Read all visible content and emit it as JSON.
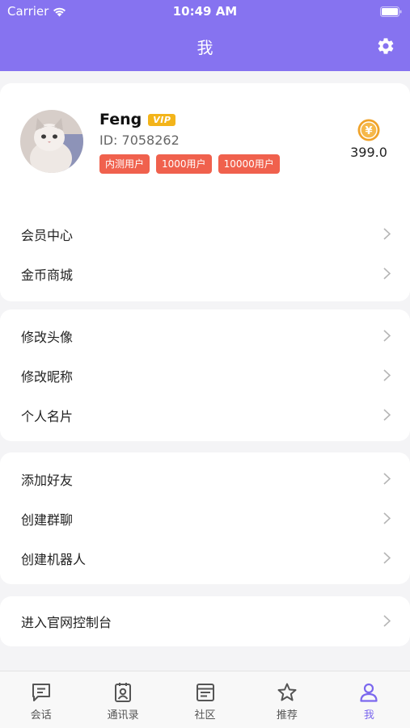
{
  "status_bar": {
    "carrier": "Carrier",
    "time": "10:49 AM"
  },
  "nav": {
    "title": "我"
  },
  "profile": {
    "name": "Feng",
    "vip_badge": "VIP",
    "id_text": "ID: 7058262",
    "tags": [
      "内测用户",
      "1000用户",
      "10000用户"
    ],
    "coins": "399.0",
    "coin_symbol": "¥"
  },
  "menu": {
    "group1": [
      "会员中心",
      "金币商城"
    ],
    "group2": [
      "修改头像",
      "修改昵称",
      "个人名片"
    ],
    "group3": [
      "添加好友",
      "创建群聊",
      "创建机器人"
    ],
    "group4": [
      "进入官网控制台"
    ]
  },
  "tabs": [
    {
      "label": "会话",
      "icon": "chat-icon"
    },
    {
      "label": "通讯录",
      "icon": "contacts-icon"
    },
    {
      "label": "社区",
      "icon": "community-icon"
    },
    {
      "label": "推荐",
      "icon": "star-icon"
    },
    {
      "label": "我",
      "icon": "person-icon",
      "active": true
    }
  ],
  "colors": {
    "accent": "#8673f0",
    "tag": "#f0614d",
    "vip": "#f3b41a",
    "coin": "#f0a32a"
  }
}
